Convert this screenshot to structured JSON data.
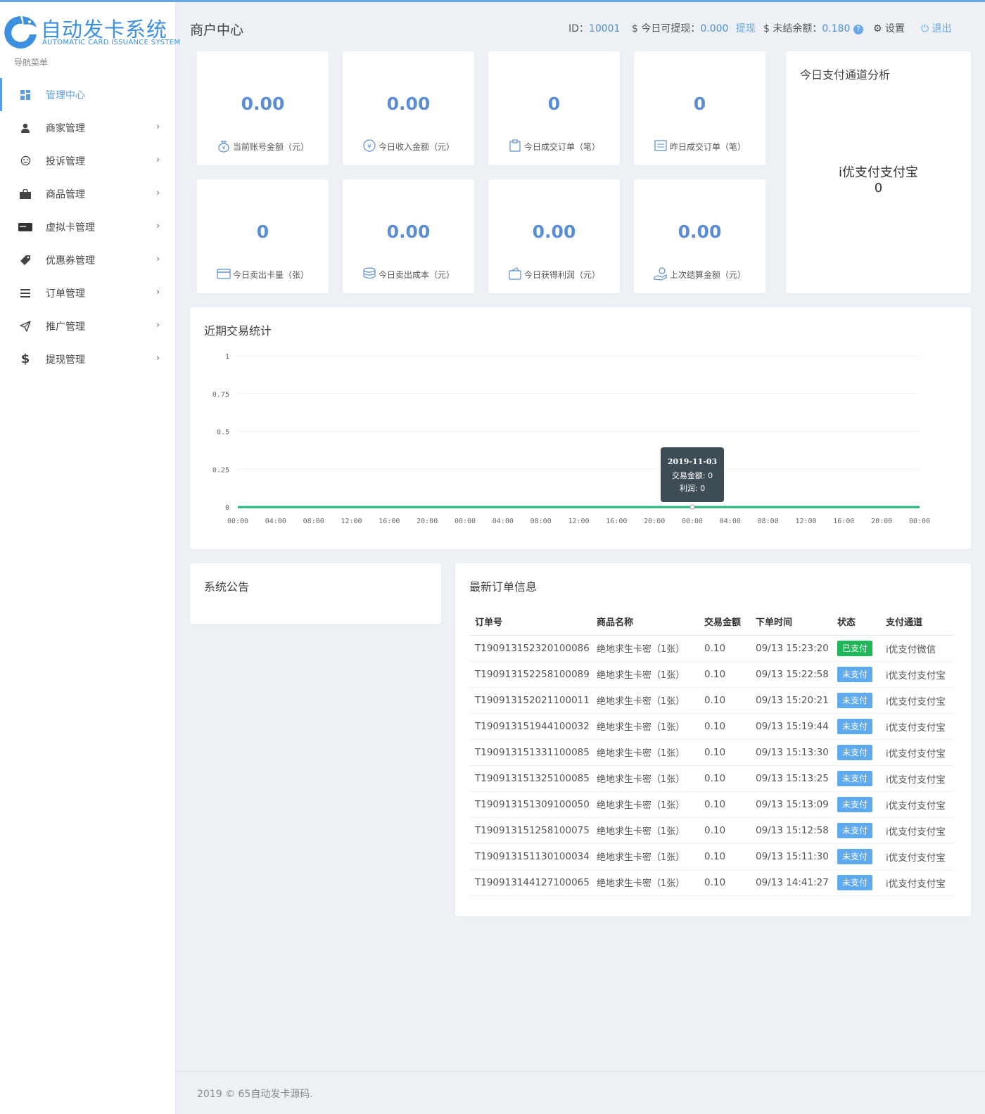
{
  "brand": {
    "title": "自动发卡系统",
    "subtitle": "AUTOMATIC CARD ISSUANCE SYSTEM"
  },
  "sidebar": {
    "nav_title": "导航菜单",
    "items": [
      {
        "label": "管理中心",
        "icon": "dashboard-icon",
        "active": true
      },
      {
        "label": "商家管理",
        "icon": "user-icon"
      },
      {
        "label": "投诉管理",
        "icon": "frown-icon"
      },
      {
        "label": "商品管理",
        "icon": "bag-icon"
      },
      {
        "label": "虚拟卡管理",
        "icon": "card-icon"
      },
      {
        "label": "优惠券管理",
        "icon": "tag-icon"
      },
      {
        "label": "订单管理",
        "icon": "list-icon"
      },
      {
        "label": "推广管理",
        "icon": "paper-plane-icon"
      },
      {
        "label": "提现管理",
        "icon": "dollar-icon"
      }
    ]
  },
  "header": {
    "title": "商户中心",
    "id_label": "ID：",
    "id_value": "10001",
    "withdraw_label": "$ 今日可提现：",
    "withdraw_value": "0.000",
    "withdraw_link": "提现",
    "unsettled_label": "$ 未结余额：",
    "unsettled_value": "0.180",
    "help": "?",
    "settings": "设置",
    "logout": "退出"
  },
  "stats": [
    {
      "value": "0.00",
      "label": "当前账号金额（元）",
      "icon": "money-bag-icon"
    },
    {
      "value": "0.00",
      "label": "今日收入金额（元）",
      "icon": "yuan-coin-icon"
    },
    {
      "value": "0",
      "label": "今日成交订单（笔）",
      "icon": "order-icon"
    },
    {
      "value": "0",
      "label": "昨日成交订单（笔）",
      "icon": "document-icon"
    },
    {
      "value": "0",
      "label": "今日卖出卡量（张）",
      "icon": "card-icon"
    },
    {
      "value": "0.00",
      "label": "今日卖出成本（元）",
      "icon": "coins-icon"
    },
    {
      "value": "0.00",
      "label": "今日获得利润（元）",
      "icon": "wallet-icon"
    },
    {
      "value": "0.00",
      "label": "上次结算金额（元）",
      "icon": "hand-money-icon"
    }
  ],
  "payment": {
    "title": "今日支付通道分析",
    "name": "i优支付支付宝",
    "value": "0"
  },
  "chart_panel": {
    "title": "近期交易统计"
  },
  "chart_data": {
    "type": "line",
    "title": "",
    "x": [
      "00:00",
      "04:00",
      "08:00",
      "12:00",
      "16:00",
      "20:00",
      "00:00",
      "04:00",
      "08:00",
      "12:00",
      "16:00",
      "20:00",
      "00:00",
      "04:00",
      "08:00",
      "12:00",
      "16:00",
      "20:00",
      "00:00"
    ],
    "series": [
      {
        "values": [
          0,
          0,
          0,
          0,
          0,
          0,
          0,
          0,
          0,
          0,
          0,
          0,
          0,
          0,
          0,
          0,
          0,
          0,
          0
        ]
      }
    ],
    "ylim": [
      0,
      1
    ],
    "yticks": [
      "1",
      "0.75",
      "0.5",
      "0.25",
      "0"
    ],
    "grid": true,
    "tooltip": {
      "date": "2019-11-03",
      "line1": "交易金额: 0",
      "line2": "利润: 0",
      "index": 12
    }
  },
  "notice": {
    "title": "系统公告"
  },
  "orders": {
    "title": "最新订单信息",
    "columns": [
      "订单号",
      "商品名称",
      "交易金额",
      "下单时间",
      "状态",
      "支付通道"
    ],
    "rows": [
      {
        "id": "T190913152320100086",
        "product": "绝地求生卡密（1张）",
        "amount": "0.10",
        "time": "09/13 15:23:20",
        "status": "已支付",
        "paid": true,
        "channel": "i优支付微信"
      },
      {
        "id": "T190913152258100089",
        "product": "绝地求生卡密（1张）",
        "amount": "0.10",
        "time": "09/13 15:22:58",
        "status": "未支付",
        "paid": false,
        "channel": "i优支付支付宝"
      },
      {
        "id": "T190913152021100011",
        "product": "绝地求生卡密（1张）",
        "amount": "0.10",
        "time": "09/13 15:20:21",
        "status": "未支付",
        "paid": false,
        "channel": "i优支付支付宝"
      },
      {
        "id": "T190913151944100032",
        "product": "绝地求生卡密（1张）",
        "amount": "0.10",
        "time": "09/13 15:19:44",
        "status": "未支付",
        "paid": false,
        "channel": "i优支付支付宝"
      },
      {
        "id": "T190913151331100085",
        "product": "绝地求生卡密（1张）",
        "amount": "0.10",
        "time": "09/13 15:13:30",
        "status": "未支付",
        "paid": false,
        "channel": "i优支付支付宝"
      },
      {
        "id": "T190913151325100085",
        "product": "绝地求生卡密（1张）",
        "amount": "0.10",
        "time": "09/13 15:13:25",
        "status": "未支付",
        "paid": false,
        "channel": "i优支付支付宝"
      },
      {
        "id": "T190913151309100050",
        "product": "绝地求生卡密（1张）",
        "amount": "0.10",
        "time": "09/13 15:13:09",
        "status": "未支付",
        "paid": false,
        "channel": "i优支付支付宝"
      },
      {
        "id": "T190913151258100075",
        "product": "绝地求生卡密（1张）",
        "amount": "0.10",
        "time": "09/13 15:12:58",
        "status": "未支付",
        "paid": false,
        "channel": "i优支付支付宝"
      },
      {
        "id": "T190913151130100034",
        "product": "绝地求生卡密（1张）",
        "amount": "0.10",
        "time": "09/13 15:11:30",
        "status": "未支付",
        "paid": false,
        "channel": "i优支付支付宝"
      },
      {
        "id": "T190913144127100065",
        "product": "绝地求生卡密（1张）",
        "amount": "0.10",
        "time": "09/13 14:41:27",
        "status": "未支付",
        "paid": false,
        "channel": "i优支付支付宝"
      }
    ]
  },
  "footer": {
    "text": "2019 © 65自动发卡源码."
  },
  "colors": {
    "accent": "#5b8dd6",
    "line": "#1fb67a",
    "paid": "#1fb65a",
    "unpaid": "#5fa9ee"
  }
}
